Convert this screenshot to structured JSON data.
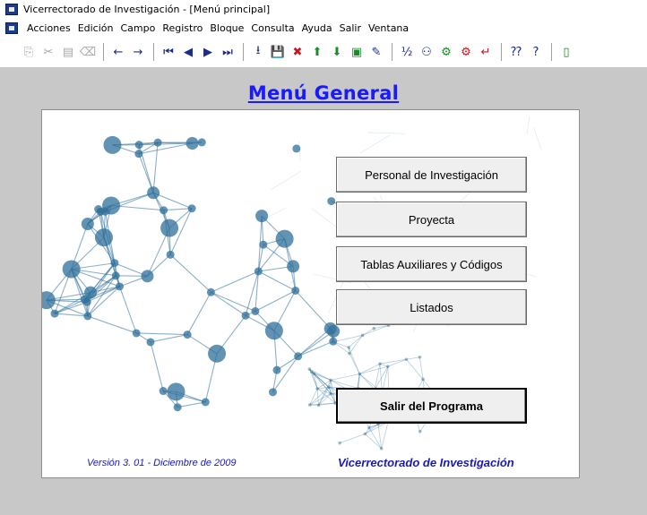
{
  "window": {
    "title": "Vicerrectorado de Investigación - [Menú principal]"
  },
  "menu": [
    "Acciones",
    "Edición",
    "Campo",
    "Registro",
    "Bloque",
    "Consulta",
    "Ayuda",
    "Salir",
    "Ventana"
  ],
  "toolbar": {
    "groups": [
      [
        {
          "name": "copy-icon",
          "glyph": "⎘",
          "state": "disabled"
        },
        {
          "name": "cut-icon",
          "glyph": "✂",
          "state": "disabled"
        },
        {
          "name": "paste-icon",
          "glyph": "▤",
          "state": "disabled"
        },
        {
          "name": "clear-icon",
          "glyph": "⌫",
          "state": "disabled"
        }
      ],
      [
        {
          "name": "arrow-left-icon",
          "glyph": "←",
          "state": "blue"
        },
        {
          "name": "arrow-right-icon",
          "glyph": "→",
          "state": "blue"
        }
      ],
      [
        {
          "name": "first-record-icon",
          "glyph": "⏮",
          "state": "blue"
        },
        {
          "name": "previous-record-icon",
          "glyph": "◀",
          "state": "blue"
        },
        {
          "name": "next-record-icon",
          "glyph": "▶",
          "state": "blue"
        },
        {
          "name": "last-record-icon",
          "glyph": "⏭",
          "state": "blue"
        }
      ],
      [
        {
          "name": "download-icon",
          "glyph": "⭳",
          "state": "blue"
        },
        {
          "name": "save-icon",
          "glyph": "💾",
          "state": "blue"
        },
        {
          "name": "delete-record-icon",
          "glyph": "✖",
          "state": "red"
        },
        {
          "name": "insert-record-up-icon",
          "glyph": "⬆",
          "state": "green"
        },
        {
          "name": "insert-record-down-icon",
          "glyph": "⬇",
          "state": "green"
        },
        {
          "name": "lock-record-icon",
          "glyph": "▣",
          "state": "green"
        },
        {
          "name": "edit-icon",
          "glyph": "✎",
          "state": "blue"
        }
      ],
      [
        {
          "name": "count-icon",
          "glyph": "½",
          "state": "blue"
        },
        {
          "name": "binoculars-icon",
          "glyph": "⚇",
          "state": "blue"
        },
        {
          "name": "query-enter-icon",
          "glyph": "⚙",
          "state": "green"
        },
        {
          "name": "query-execute-icon",
          "glyph": "⚙",
          "state": "red"
        },
        {
          "name": "return-icon",
          "glyph": "↵",
          "state": "red"
        }
      ],
      [
        {
          "name": "context-help-icon",
          "glyph": "⁇",
          "state": "blue"
        },
        {
          "name": "help-icon",
          "glyph": "?",
          "state": "blue"
        }
      ],
      [
        {
          "name": "exit-door-icon",
          "glyph": "▯",
          "state": "green"
        }
      ]
    ]
  },
  "main": {
    "heading": "Menú General",
    "buttons": {
      "personal": "Personal de Investigación",
      "proyecta": "Proyecta",
      "tablas": "Tablas Auxiliares y Códigos",
      "listados": "Listados",
      "salir": "Salir del Programa"
    },
    "version": "Versión 3. 01 - Diciembre de 2009",
    "institution": "Vicerrectorado de Investigación"
  },
  "colors": {
    "heading": "#1a1aff",
    "footer_text": "#1a1ab4",
    "background": "#c8c8c8",
    "network": "#2f6f9a"
  }
}
